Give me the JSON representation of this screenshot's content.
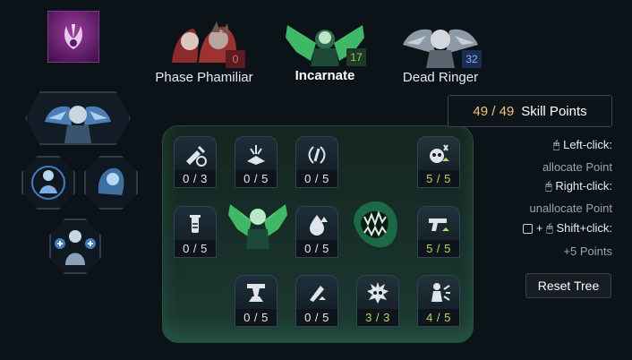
{
  "trees": [
    {
      "name": "Phase Phamiliar",
      "count": "0",
      "count_bg": "#5a1c22",
      "count_color": "#e46a6a"
    },
    {
      "name": "Incarnate",
      "count": "17",
      "count_bg": "#1f3a28",
      "count_color": "#8ed66a"
    },
    {
      "name": "Dead Ringer",
      "count": "32",
      "count_bg": "#1c2d52",
      "count_color": "#8db2ef"
    }
  ],
  "skill_points": {
    "current": "49",
    "separator": "/",
    "max": "49",
    "label": "Skill Points"
  },
  "hints": {
    "left_click": "Left-click:",
    "left_click_desc": "allocate Point",
    "right_click": "Right-click:",
    "right_click_desc": "unallocate Point",
    "shift_click": "Shift+click:",
    "shift_click_plus": "+",
    "shift_click_desc": "+5 Points"
  },
  "reset_button": "Reset Tree",
  "nodes": [
    {
      "name": "syringe-timer-icon",
      "rank": "0 / 3"
    },
    {
      "name": "burst-up-icon",
      "rank": "0 / 5"
    },
    {
      "name": "radio-wave-icon",
      "rank": "0 / 5"
    },
    {
      "name": "skull-burst-icon",
      "rank": "5 / 5"
    },
    {
      "name": "vial-icon",
      "rank": "0 / 5"
    },
    {
      "name": "drop-icon",
      "rank": "0 / 5"
    },
    {
      "name": "pistol-icon",
      "rank": "5 / 5"
    },
    {
      "name": "stomp-icon",
      "rank": "0 / 5"
    },
    {
      "name": "blade-up-icon",
      "rank": "0 / 5"
    },
    {
      "name": "spiky-skull-icon",
      "rank": "3 / 3"
    },
    {
      "name": "figure-burst-icon",
      "rank": "4 / 5"
    }
  ]
}
